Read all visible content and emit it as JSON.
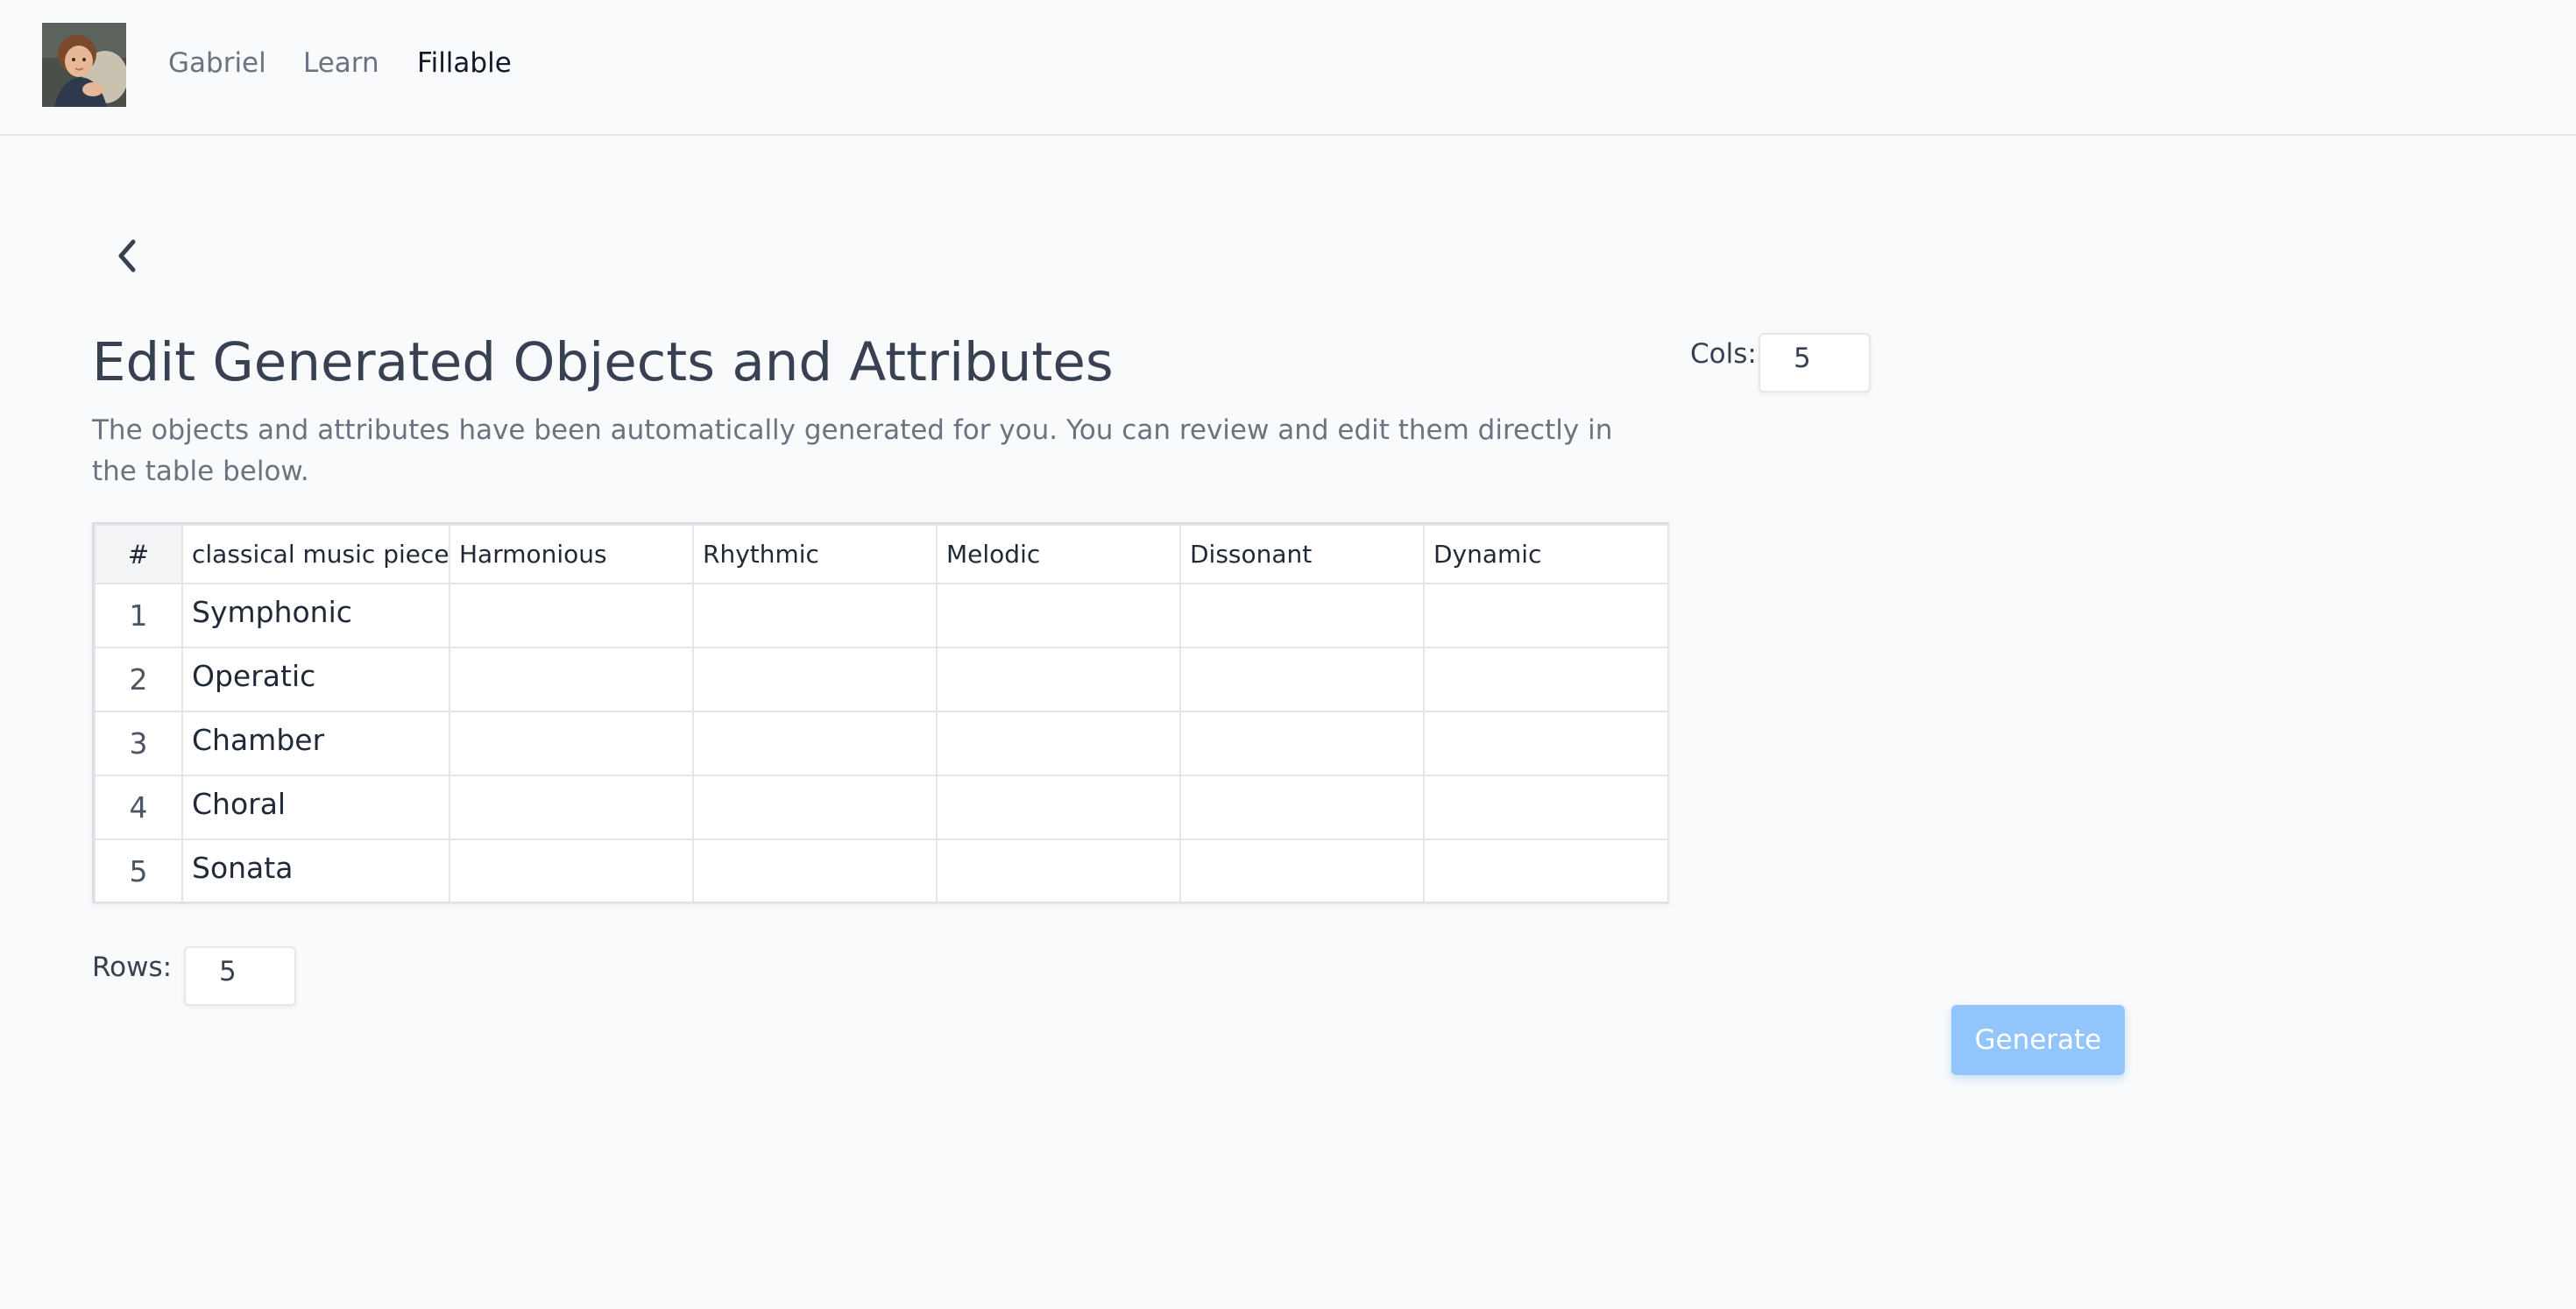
{
  "nav": {
    "avatar_alt": "profile avatar",
    "links": [
      {
        "label": "Gabriel",
        "active": false
      },
      {
        "label": "Learn",
        "active": false
      },
      {
        "label": "Fillable",
        "active": true
      }
    ]
  },
  "page": {
    "back_icon": "chevron-left-icon",
    "title": "Edit Generated Objects and Attributes",
    "subtitle": "The objects and attributes have been automatically generated for you. You can review and edit them directly in the table below."
  },
  "controls": {
    "cols_label": "Cols:",
    "cols_value": "5",
    "rows_label": "Rows:",
    "rows_value": "5",
    "generate_label": "Generate"
  },
  "table": {
    "index_header": "#",
    "object_header": "classical music pieces",
    "attributes": [
      "Harmonious",
      "Rhythmic",
      "Melodic",
      "Dissonant",
      "Dynamic"
    ],
    "rows": [
      {
        "index": "1",
        "object": "Symphonic",
        "cells": [
          "",
          "",
          "",
          "",
          ""
        ]
      },
      {
        "index": "2",
        "object": "Operatic",
        "cells": [
          "",
          "",
          "",
          "",
          ""
        ]
      },
      {
        "index": "3",
        "object": "Chamber",
        "cells": [
          "",
          "",
          "",
          "",
          ""
        ]
      },
      {
        "index": "4",
        "object": "Choral",
        "cells": [
          "",
          "",
          "",
          "",
          ""
        ]
      },
      {
        "index": "5",
        "object": "Sonata",
        "cells": [
          "",
          "",
          "",
          "",
          ""
        ]
      }
    ]
  },
  "colors": {
    "accent_disabled": "#93c5fd",
    "text_primary": "#374151",
    "text_muted": "#6b7280",
    "background": "#f9fafb"
  }
}
